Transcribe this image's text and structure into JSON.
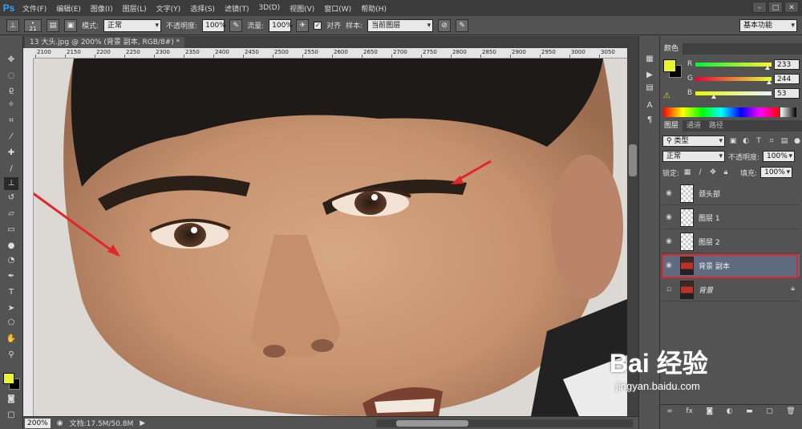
{
  "menubar": {
    "logo": "Ps",
    "items": [
      "文件(F)",
      "编辑(E)",
      "图像(I)",
      "图层(L)",
      "文字(Y)",
      "选择(S)",
      "滤镜(T)",
      "3D(D)",
      "视图(V)",
      "窗口(W)",
      "帮助(H)"
    ],
    "window_controls": [
      "–",
      "□",
      "✕"
    ]
  },
  "options": {
    "brush_size": "21",
    "mode_label": "模式:",
    "mode_value": "正常",
    "opacity_label": "不透明度:",
    "opacity_value": "100%",
    "flow_label": "流量:",
    "flow_value": "100%",
    "align_label": "对齐",
    "sample_label": "样本:",
    "sample_value": "当前图层",
    "workspace": "基本功能"
  },
  "document": {
    "tab_title": "13 大头.jpg @ 200% (背景 副本, RGB/8#) *",
    "ruler_ticks": [
      "2100",
      "2150",
      "2200",
      "2250",
      "2300",
      "2350",
      "2400",
      "2450",
      "2500",
      "2550",
      "2600",
      "2650",
      "2700",
      "2750",
      "2800",
      "2850",
      "2900",
      "2950",
      "3000",
      "3050"
    ]
  },
  "status": {
    "zoom": "200%",
    "doc_info": "文档:17.5M/50.8M"
  },
  "color_panel": {
    "tab": "颜色",
    "r_label": "R",
    "r_value": "233",
    "g_label": "G",
    "g_value": "244",
    "b_label": "B",
    "b_value": "53",
    "fg_color": "#e9f435",
    "bg_color": "#000000"
  },
  "layers_panel": {
    "tabs": [
      "图层",
      "通道",
      "路径"
    ],
    "filter_value": "类型",
    "blend_value": "正常",
    "opacity_label": "不透明度:",
    "opacity_value": "100%",
    "lock_label": "锁定:",
    "fill_label": "填充:",
    "fill_value": "100%",
    "layers": [
      {
        "name": "颈头部",
        "visible": true,
        "selected": false,
        "locked": false
      },
      {
        "name": "图层 1",
        "visible": true,
        "selected": false,
        "locked": false
      },
      {
        "name": "图层 2",
        "visible": true,
        "selected": false,
        "locked": false
      },
      {
        "name": "背景 副本",
        "visible": true,
        "selected": true,
        "locked": false
      },
      {
        "name": "背景",
        "visible": false,
        "selected": false,
        "locked": true
      }
    ],
    "footer_icons": [
      "link-icon",
      "fx-icon",
      "mask-icon",
      "adjustment-icon",
      "group-icon",
      "new-layer-icon",
      "trash-icon"
    ]
  },
  "watermark": {
    "logo": "Bai 经验",
    "url": "jingyan.baidu.com"
  },
  "accent_red": "#e0262a"
}
